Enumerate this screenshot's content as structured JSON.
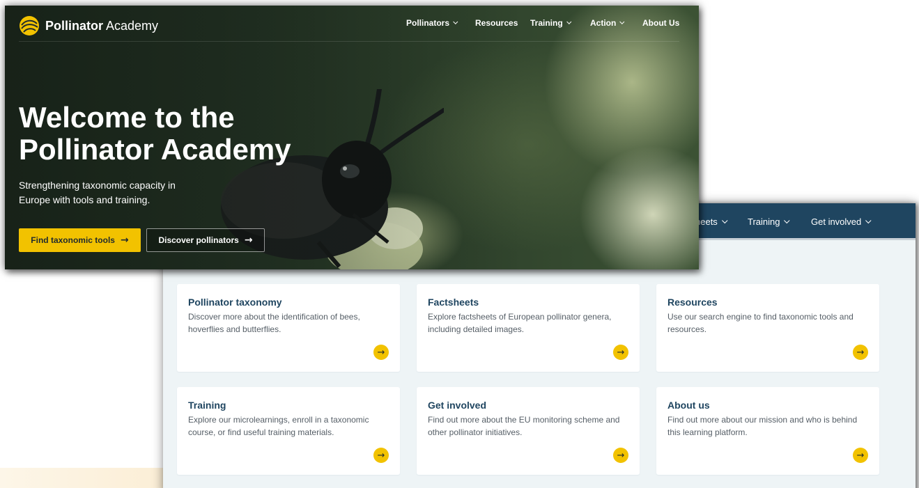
{
  "front": {
    "logo": {
      "bold": "Pollinator",
      "light": " Academy"
    },
    "nav": [
      {
        "label": "Pollinators",
        "dropdown": true
      },
      {
        "label": "Resources",
        "dropdown": false
      },
      {
        "label": "Training",
        "dropdown": true
      },
      {
        "label": "Action",
        "dropdown": true
      },
      {
        "label": "About Us",
        "dropdown": false
      }
    ],
    "hero": {
      "title_line1": "Welcome to the",
      "title_line2": "Pollinator Academy",
      "subtitle_line1": "Strengthening taxonomic capacity in",
      "subtitle_line2": "Europe with tools and training."
    },
    "buttons": {
      "primary": "Find taxonomic tools",
      "secondary": "Discover pollinators",
      "arrow": "→"
    }
  },
  "back": {
    "nav": [
      {
        "label": "heets",
        "dropdown": true
      },
      {
        "label": "Training",
        "dropdown": true
      },
      {
        "label": "Get involved",
        "dropdown": true
      }
    ],
    "cards": [
      {
        "title": "Pollinator taxonomy",
        "desc": "Discover more about the identification of bees, hoverflies and butterflies."
      },
      {
        "title": "Factsheets",
        "desc": "Explore factsheets of European pollinator genera, including detailed images."
      },
      {
        "title": "Resources",
        "desc": "Use our search engine to find taxonomic tools and resources."
      },
      {
        "title": "Training",
        "desc": "Explore our microlearnings, enroll in a taxonomic course, or find useful training materials."
      },
      {
        "title": "Get involved",
        "desc": "Find out more about the EU monitoring scheme and other pollinator initiatives."
      },
      {
        "title": "About us",
        "desc": "Find out more about our mission and who is behind this learning platform."
      }
    ],
    "card_arrow": "→"
  },
  "colors": {
    "accent_yellow": "#f2c200",
    "navy": "#1f4560",
    "card_bg": "#ffffff",
    "page_bg": "#eef4f6"
  },
  "icons": {
    "logo": "pollinator-logo-icon",
    "chevron": "chevron-down-icon",
    "arrow": "arrow-right-icon"
  }
}
